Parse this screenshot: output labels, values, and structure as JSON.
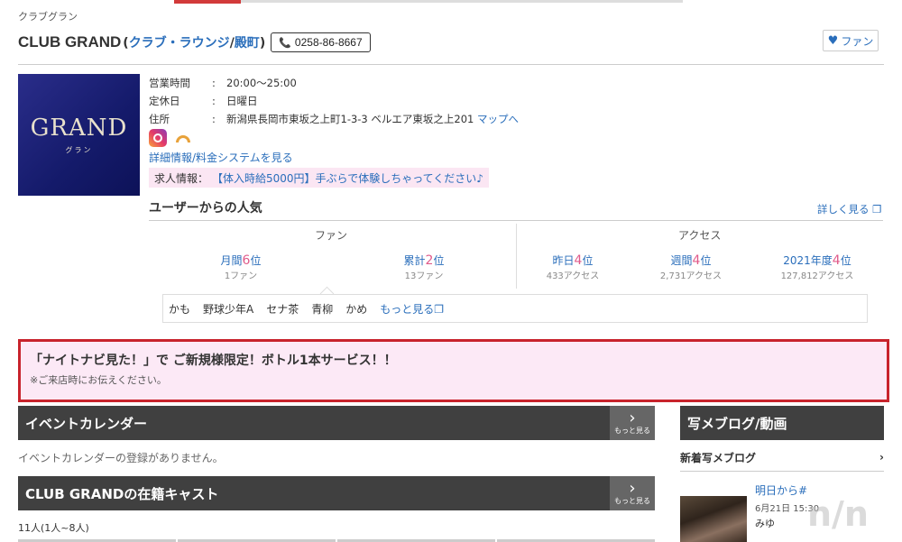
{
  "header": {
    "category": "クラブグラン",
    "title": "CLUB GRAND",
    "type_open": "(",
    "type_link": "クラブ・ラウンジ",
    "slash": "/",
    "area_link": "殿町",
    "type_close": ")",
    "tel": "0258-86-8667",
    "fan_label": "ファン"
  },
  "logo": {
    "main": "GRAND",
    "sub": "グラン"
  },
  "info": {
    "hours_label": "営業時間",
    "hours_value": "20:00〜25:00",
    "holiday_label": "定休日",
    "holiday_value": "日曜日",
    "address_label": "住所",
    "address_value": "新潟県長岡市東坂之上町1-3-3 ベルエア東坂之上201",
    "map_link": "マップへ",
    "separator": ":",
    "detail_link": "詳細情報/料金システムを見る",
    "recruit_label": "求人情報：",
    "recruit_text": "【体入時給5000円】手ぶらで体験しちゃってください♪"
  },
  "popularity": {
    "heading": "ユーザーからの人気",
    "more": "詳しく見る",
    "fan_heading": "ファン",
    "access_heading": "アクセス",
    "ranks": [
      {
        "label": "月間",
        "num": "6",
        "unit": "位",
        "sub": "1ファン"
      },
      {
        "label": "累計",
        "num": "2",
        "unit": "位",
        "sub": "13ファン"
      },
      {
        "label": "昨日",
        "num": "4",
        "unit": "位",
        "sub": "433アクセス"
      },
      {
        "label": "週間",
        "num": "4",
        "unit": "位",
        "sub": "2,731アクセス"
      },
      {
        "label": "2021年度",
        "num": "4",
        "unit": "位",
        "sub": "127,812アクセス"
      }
    ],
    "fans": [
      "かも",
      "野球少年A",
      "セナ茶",
      "青柳",
      "かめ"
    ],
    "fans_more": "もっと見る"
  },
  "promo": {
    "main": "「ナイトナビ見た！」で ご新規様限定！ボトル1本サービス！！",
    "sub": "※ご来店時にお伝えください。"
  },
  "events": {
    "title": "イベントカレンダー",
    "more": "もっと見る",
    "empty": "イベントカレンダーの登録がありません。"
  },
  "cast": {
    "title": "CLUB GRANDの在籍キャスト",
    "more": "もっと見る",
    "count": "11人(1人~8人)"
  },
  "sidebar": {
    "title": "写メブログ/動画",
    "new_label": "新着写メブログ",
    "blog_title": "明日から#",
    "blog_date": "6月21日 15:30",
    "blog_name": "みゆ"
  },
  "watermark": "n/n",
  "colors": {
    "accent_link": "#2a6ebb",
    "rank_num": "#e05a8a",
    "promo_border": "#c8232c",
    "bar_dark": "#404040"
  }
}
